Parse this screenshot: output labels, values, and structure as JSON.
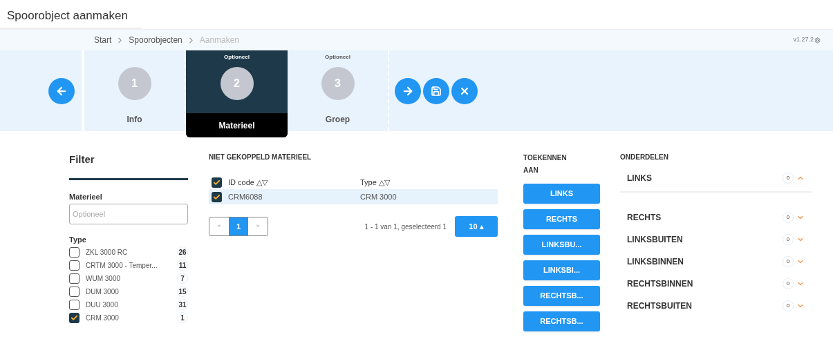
{
  "page_title": "Spoorobject aanmaken",
  "breadcrumb": [
    {
      "label": "Start",
      "current": false
    },
    {
      "label": "Spoorobjecten",
      "current": false
    },
    {
      "label": "Aanmaken",
      "current": true
    }
  ],
  "version": "v1.27.2",
  "steps": [
    {
      "number": "1",
      "label": "Info",
      "selected": false
    },
    {
      "number": "2",
      "label": "Materieel",
      "note": "Optioneel",
      "selected": true
    },
    {
      "number": "3",
      "label": "Groep",
      "note": "Optioneel",
      "selected": false
    }
  ],
  "filter": {
    "title": "Filter",
    "materieel_label": "Materieel",
    "materieel_placeholder": "Optioneel",
    "type_label": "Type",
    "types": [
      {
        "label": "ZKL 3000 RC",
        "count": "26",
        "checked": false
      },
      {
        "label": "CRTM 3000 - Temper...",
        "count": "11",
        "checked": false
      },
      {
        "label": "WUM 3000",
        "count": "7",
        "checked": false
      },
      {
        "label": "DUM 3000",
        "count": "15",
        "checked": false
      },
      {
        "label": "DUU 3000",
        "count": "31",
        "checked": false
      },
      {
        "label": "CRM 3000",
        "count": "1",
        "checked": true
      }
    ]
  },
  "table": {
    "title": "NIET GEKOPPELD MATERIEEL",
    "all_checked": true,
    "columns": [
      "ID code △▽",
      "Type △▽"
    ],
    "rows": [
      {
        "cells": [
          "CRM6088",
          "CRM 3000"
        ],
        "checked": true
      }
    ],
    "pagination": {
      "prev": "«",
      "pages": [
        {
          "label": "1",
          "selected": true
        }
      ],
      "next": "»"
    },
    "summary": "1 - 1 van 1, geselecteerd 1",
    "page_size": "10 ▴"
  },
  "assign": {
    "title": "TOEKENNEN AAN",
    "buttons": [
      "LINKS",
      "RECHTS",
      "LINKSBU...",
      "LINKSBI...",
      "RECHTSB...",
      "RECHTSB..."
    ]
  },
  "parts": {
    "title": "ONDERDELEN",
    "items": [
      {
        "label": "LINKS",
        "count": "0",
        "expanded": true
      },
      {
        "label": "RECHTS",
        "count": "0",
        "expanded": false
      },
      {
        "label": "LINKSBUITEN",
        "count": "0",
        "expanded": false
      },
      {
        "label": "LINKSBINNEN",
        "count": "0",
        "expanded": false
      },
      {
        "label": "RECHTSBINNEN",
        "count": "0",
        "expanded": false
      },
      {
        "label": "RECHTSBUITEN",
        "count": "0",
        "expanded": false
      }
    ]
  }
}
